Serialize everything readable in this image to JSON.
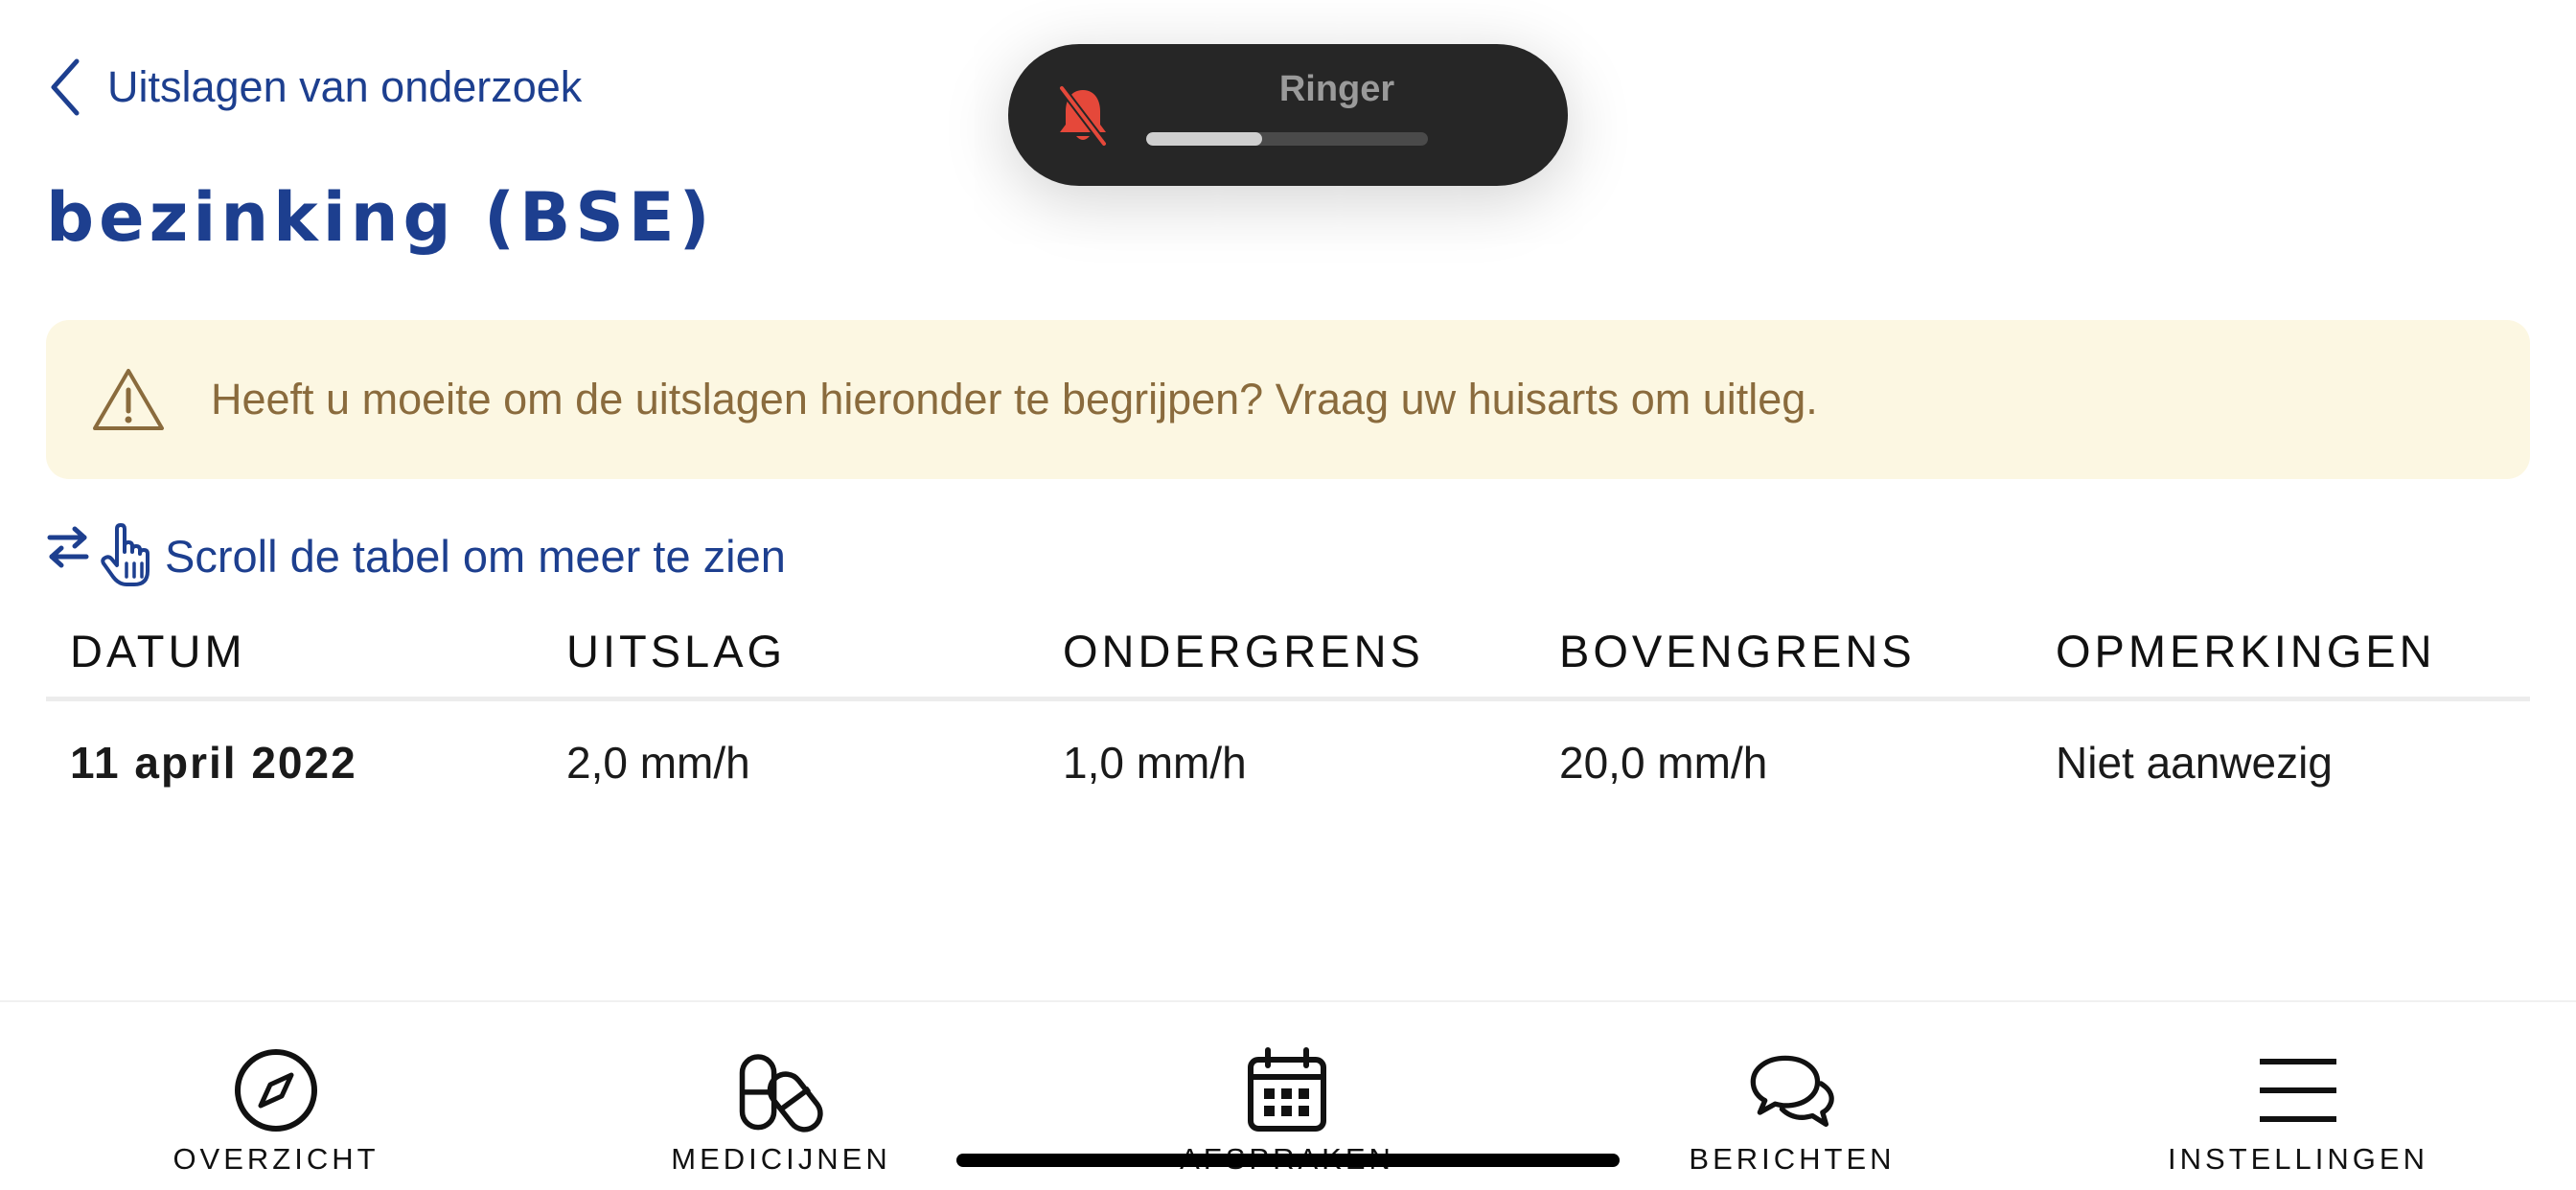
{
  "nav": {
    "back_label": "Uitslagen van onderzoek"
  },
  "page": {
    "title": "bezinking (BSE)"
  },
  "ringer": {
    "label": "Ringer",
    "volume_fraction": 0.41,
    "icon": "bell-slash-icon",
    "icon_color": "#e5483a"
  },
  "warning": {
    "icon": "warning-triangle-icon",
    "text": "Heeft u moeite om de uitslagen hieronder te begrijpen? Vraag uw huisarts om uitleg."
  },
  "scroll_hint": {
    "text": "Scroll de tabel om meer te zien"
  },
  "table": {
    "columns": [
      "DATUM",
      "UITSLAG",
      "ONDERGRENS",
      "BOVENGRENS",
      "OPMERKINGEN"
    ],
    "rows": [
      [
        "11 april 2022",
        "2,0 mm/h",
        "1,0 mm/h",
        "20,0 mm/h",
        "Niet aanwezig"
      ]
    ]
  },
  "tabs": [
    {
      "label": "OVERZICHT",
      "icon": "compass-icon"
    },
    {
      "label": "MEDICIJNEN",
      "icon": "pills-icon"
    },
    {
      "label": "AFSPRAKEN",
      "icon": "calendar-icon"
    },
    {
      "label": "BERICHTEN",
      "icon": "chat-bubbles-icon"
    },
    {
      "label": "INSTELLINGEN",
      "icon": "menu-icon"
    }
  ],
  "colors": {
    "accent": "#1d3f8f",
    "warning_bg": "#fcf7e2",
    "warning_text": "#8a6b3d"
  }
}
